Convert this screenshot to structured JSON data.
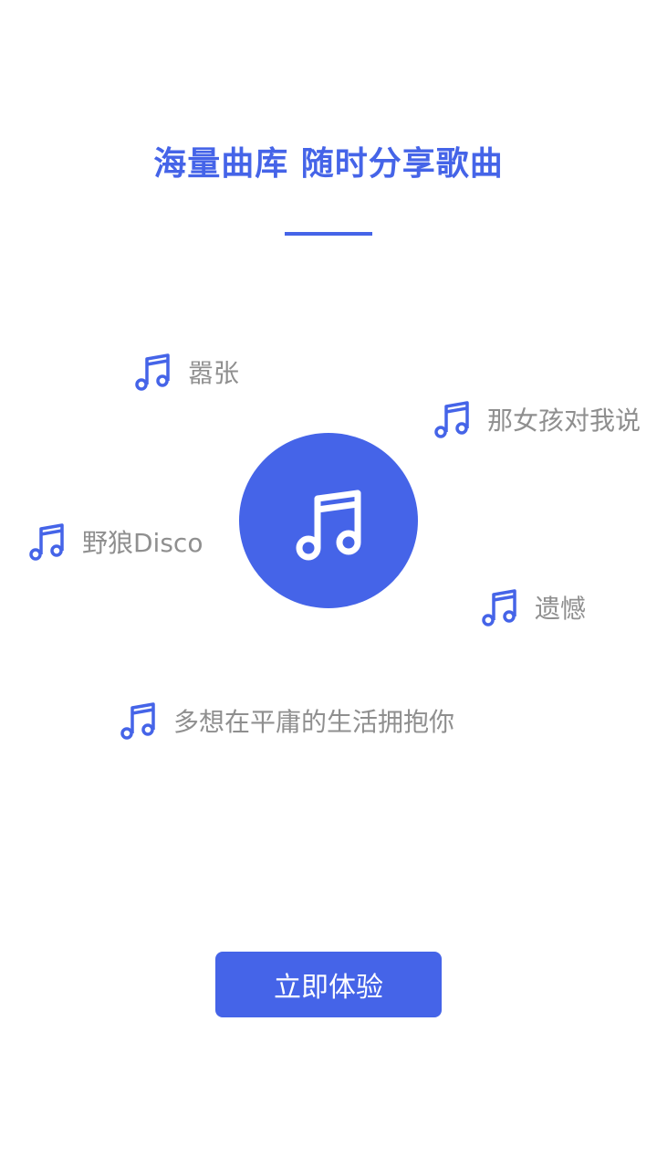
{
  "header": {
    "title": "海量曲库  随时分享歌曲"
  },
  "center": {
    "icon": "music-note-icon"
  },
  "songs": [
    {
      "label": "嚣张",
      "icon": "music-note-icon"
    },
    {
      "label": "那女孩对我说",
      "icon": "music-note-icon"
    },
    {
      "label": "野狼Disco",
      "icon": "music-note-icon"
    },
    {
      "label": "遗憾",
      "icon": "music-note-icon"
    },
    {
      "label": "多想在平庸的生活拥抱你",
      "icon": "music-note-icon"
    }
  ],
  "cta": {
    "label": "立即体验"
  },
  "colors": {
    "accent": "#4564e8",
    "song_text": "#8f8f8f",
    "background": "#ffffff"
  }
}
